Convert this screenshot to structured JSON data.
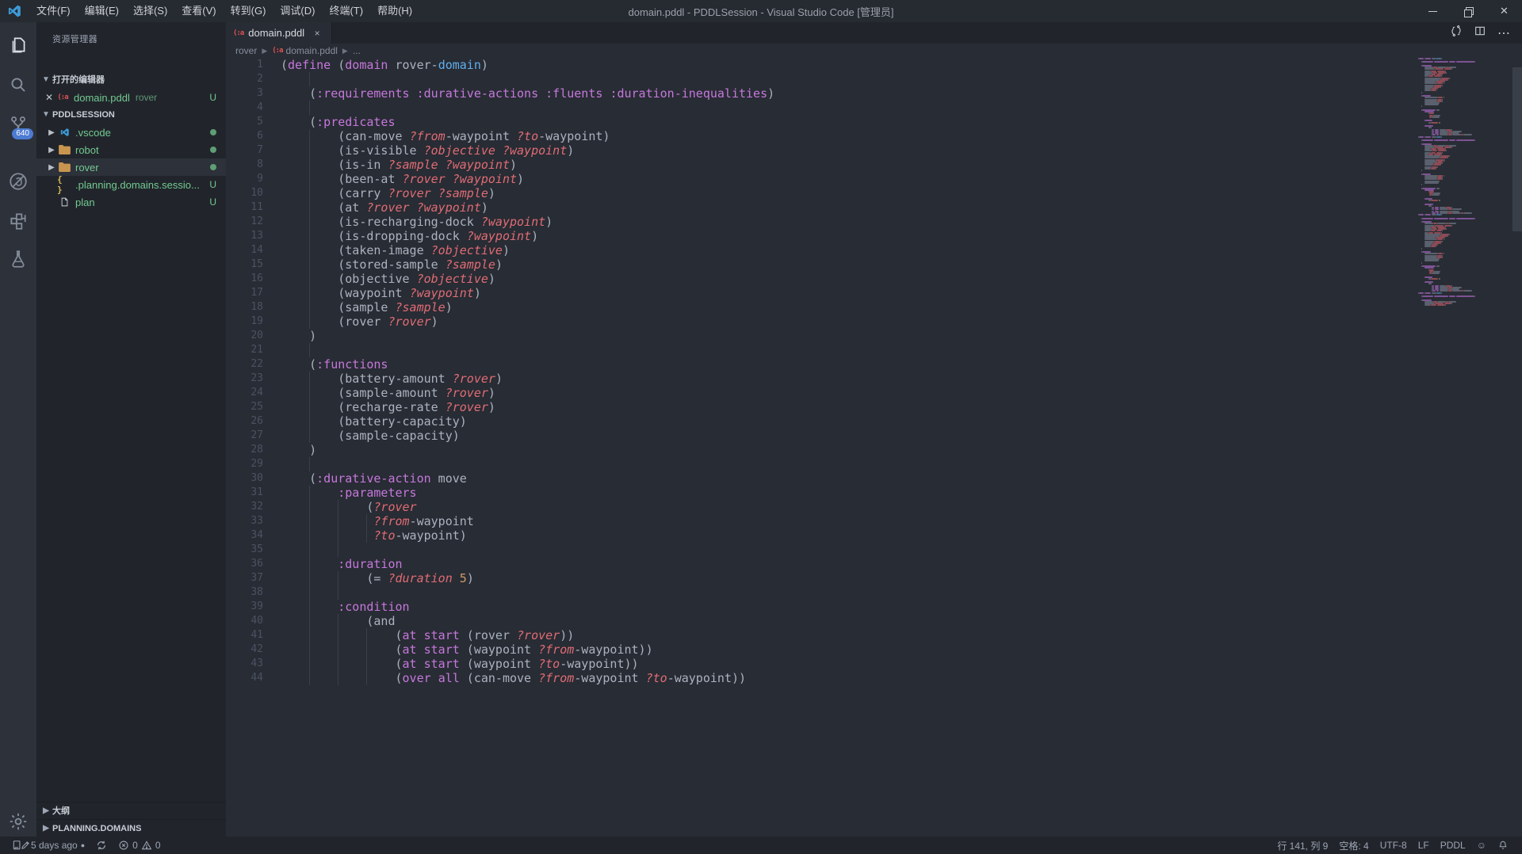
{
  "title_bar": {
    "menus": [
      {
        "label": "文件(F)"
      },
      {
        "label": "编辑(E)"
      },
      {
        "label": "选择(S)"
      },
      {
        "label": "查看(V)"
      },
      {
        "label": "转到(G)"
      },
      {
        "label": "调试(D)"
      },
      {
        "label": "终端(T)"
      },
      {
        "label": "帮助(H)"
      }
    ],
    "title": "domain.pddl - PDDLSession - Visual Studio Code [管理员]"
  },
  "activity_bar": {
    "items": [
      {
        "name": "explorer",
        "active": true
      },
      {
        "name": "search",
        "active": false
      },
      {
        "name": "source-control",
        "active": false,
        "badge": "640"
      },
      {
        "name": "debug-disabled",
        "active": false
      },
      {
        "name": "extensions",
        "active": false
      },
      {
        "name": "test-explorer",
        "active": false
      }
    ]
  },
  "sidebar": {
    "title": "资源管理器",
    "open_editors_label": "打开的编辑器",
    "open_editors": [
      {
        "name": "domain.pddl",
        "description": "rover",
        "badge": "U",
        "icon": "pddl"
      }
    ],
    "project_label": "PDDLSESSION",
    "tree": [
      {
        "name": ".vscode",
        "icon": "vscode",
        "chevron": true,
        "dot": true
      },
      {
        "name": "robot",
        "icon": "folder",
        "chevron": true,
        "dot": true
      },
      {
        "name": "rover",
        "icon": "folder",
        "chevron": true,
        "dot": true,
        "selected": true
      },
      {
        "name": ".planning.domains.sessio...",
        "icon": "json",
        "badge": "U"
      },
      {
        "name": "plan",
        "icon": "file",
        "badge": "U"
      }
    ],
    "outline_label": "大纲",
    "planning_domains_label": "PLANNING.DOMAINS"
  },
  "editor": {
    "tab": {
      "name": "domain.pddl",
      "icon_text": "(:a",
      "close": "×"
    },
    "breadcrumb": {
      "folder": "rover",
      "file": "domain.pddl",
      "tail": "...",
      "icon_text": "(:a"
    },
    "pddl_icon_color": "#e05252",
    "lines": [
      [
        1,
        [],
        [
          [
            "p",
            "("
          ],
          [
            "k",
            "define"
          ],
          [
            "p",
            " ("
          ],
          [
            "k",
            "domain"
          ],
          [
            "p",
            " rover-"
          ],
          [
            "b",
            "domain"
          ],
          [
            "p",
            ")"
          ]
        ]
      ],
      [
        2,
        [
          4
        ],
        []
      ],
      [
        3,
        [],
        [
          [
            "p",
            "    ("
          ],
          [
            "k",
            ":requirements"
          ],
          [
            "p",
            " "
          ],
          [
            "k",
            ":durative-actions"
          ],
          [
            "p",
            " "
          ],
          [
            "k",
            ":fluents"
          ],
          [
            "p",
            " "
          ],
          [
            "k",
            ":duration-inequalities"
          ],
          [
            "p",
            ")"
          ]
        ]
      ],
      [
        4,
        [
          4
        ],
        []
      ],
      [
        5,
        [],
        [
          [
            "p",
            "    ("
          ],
          [
            "k",
            ":predicates"
          ]
        ]
      ],
      [
        6,
        [
          4
        ],
        [
          [
            "p",
            "        (can-move "
          ],
          [
            "v",
            "?from"
          ],
          [
            "p",
            "-waypoint "
          ],
          [
            "v",
            "?to"
          ],
          [
            "p",
            "-waypoint)"
          ]
        ]
      ],
      [
        7,
        [
          4
        ],
        [
          [
            "p",
            "        (is-visible "
          ],
          [
            "v",
            "?objective"
          ],
          [
            "p",
            " "
          ],
          [
            "v",
            "?waypoint"
          ],
          [
            "p",
            ")"
          ]
        ]
      ],
      [
        8,
        [
          4
        ],
        [
          [
            "p",
            "        (is-in "
          ],
          [
            "v",
            "?sample"
          ],
          [
            "p",
            " "
          ],
          [
            "v",
            "?waypoint"
          ],
          [
            "p",
            ")"
          ]
        ]
      ],
      [
        9,
        [
          4
        ],
        [
          [
            "p",
            "        (been-at "
          ],
          [
            "v",
            "?rover"
          ],
          [
            "p",
            " "
          ],
          [
            "v",
            "?waypoint"
          ],
          [
            "p",
            ")"
          ]
        ]
      ],
      [
        10,
        [
          4
        ],
        [
          [
            "p",
            "        (carry "
          ],
          [
            "v",
            "?rover"
          ],
          [
            "p",
            " "
          ],
          [
            "v",
            "?sample"
          ],
          [
            "p",
            ")"
          ]
        ]
      ],
      [
        11,
        [
          4
        ],
        [
          [
            "p",
            "        (at "
          ],
          [
            "v",
            "?rover"
          ],
          [
            "p",
            " "
          ],
          [
            "v",
            "?waypoint"
          ],
          [
            "p",
            ")"
          ]
        ]
      ],
      [
        12,
        [
          4
        ],
        [
          [
            "p",
            "        (is-recharging-dock "
          ],
          [
            "v",
            "?waypoint"
          ],
          [
            "p",
            ")"
          ]
        ]
      ],
      [
        13,
        [
          4
        ],
        [
          [
            "p",
            "        (is-dropping-dock "
          ],
          [
            "v",
            "?waypoint"
          ],
          [
            "p",
            ")"
          ]
        ]
      ],
      [
        14,
        [
          4
        ],
        [
          [
            "p",
            "        (taken-image "
          ],
          [
            "v",
            "?objective"
          ],
          [
            "p",
            ")"
          ]
        ]
      ],
      [
        15,
        [
          4
        ],
        [
          [
            "p",
            "        (stored-sample "
          ],
          [
            "v",
            "?sample"
          ],
          [
            "p",
            ")"
          ]
        ]
      ],
      [
        16,
        [
          4
        ],
        [
          [
            "p",
            "        (objective "
          ],
          [
            "v",
            "?objective"
          ],
          [
            "p",
            ")"
          ]
        ]
      ],
      [
        17,
        [
          4
        ],
        [
          [
            "p",
            "        (waypoint "
          ],
          [
            "v",
            "?waypoint"
          ],
          [
            "p",
            ")"
          ]
        ]
      ],
      [
        18,
        [
          4
        ],
        [
          [
            "p",
            "        (sample "
          ],
          [
            "v",
            "?sample"
          ],
          [
            "p",
            ")"
          ]
        ]
      ],
      [
        19,
        [
          4
        ],
        [
          [
            "p",
            "        (rover "
          ],
          [
            "v",
            "?rover"
          ],
          [
            "p",
            ")"
          ]
        ]
      ],
      [
        20,
        [],
        [
          [
            "p",
            "    )"
          ]
        ]
      ],
      [
        21,
        [
          4
        ],
        []
      ],
      [
        22,
        [],
        [
          [
            "p",
            "    ("
          ],
          [
            "k",
            ":functions"
          ]
        ]
      ],
      [
        23,
        [
          4
        ],
        [
          [
            "p",
            "        (battery-amount "
          ],
          [
            "v",
            "?rover"
          ],
          [
            "p",
            ")"
          ]
        ]
      ],
      [
        24,
        [
          4
        ],
        [
          [
            "p",
            "        (sample-amount "
          ],
          [
            "v",
            "?rover"
          ],
          [
            "p",
            ")"
          ]
        ]
      ],
      [
        25,
        [
          4
        ],
        [
          [
            "p",
            "        (recharge-rate "
          ],
          [
            "v",
            "?rover"
          ],
          [
            "p",
            ")"
          ]
        ]
      ],
      [
        26,
        [
          4
        ],
        [
          [
            "p",
            "        (battery-capacity)"
          ]
        ]
      ],
      [
        27,
        [
          4
        ],
        [
          [
            "p",
            "        (sample-capacity)"
          ]
        ]
      ],
      [
        28,
        [],
        [
          [
            "p",
            "    )"
          ]
        ]
      ],
      [
        29,
        [
          4
        ],
        []
      ],
      [
        30,
        [],
        [
          [
            "p",
            "    ("
          ],
          [
            "k",
            ":durative-action"
          ],
          [
            "p",
            " move"
          ]
        ]
      ],
      [
        31,
        [
          4
        ],
        [
          [
            "p",
            "        "
          ],
          [
            "k",
            ":parameters"
          ]
        ]
      ],
      [
        32,
        [
          4,
          8
        ],
        [
          [
            "p",
            "            ("
          ],
          [
            "v",
            "?rover"
          ]
        ]
      ],
      [
        33,
        [
          4,
          8,
          12
        ],
        [
          [
            "p",
            "             "
          ],
          [
            "v",
            "?from"
          ],
          [
            "p",
            "-waypoint"
          ]
        ]
      ],
      [
        34,
        [
          4,
          8,
          12
        ],
        [
          [
            "p",
            "             "
          ],
          [
            "v",
            "?to"
          ],
          [
            "p",
            "-waypoint)"
          ]
        ]
      ],
      [
        35,
        [
          4,
          8
        ],
        []
      ],
      [
        36,
        [
          4
        ],
        [
          [
            "p",
            "        "
          ],
          [
            "k",
            ":duration"
          ]
        ]
      ],
      [
        37,
        [
          4,
          8
        ],
        [
          [
            "p",
            "            (= "
          ],
          [
            "v",
            "?duration"
          ],
          [
            "p",
            " "
          ],
          [
            "n",
            "5"
          ],
          [
            "p",
            ")"
          ]
        ]
      ],
      [
        38,
        [
          4,
          8
        ],
        []
      ],
      [
        39,
        [
          4
        ],
        [
          [
            "p",
            "        "
          ],
          [
            "k",
            ":condition"
          ]
        ]
      ],
      [
        40,
        [
          4,
          8
        ],
        [
          [
            "p",
            "            (and"
          ]
        ]
      ],
      [
        41,
        [
          4,
          8,
          12
        ],
        [
          [
            "p",
            "                ("
          ],
          [
            "k",
            "at"
          ],
          [
            "p",
            " "
          ],
          [
            "k",
            "start"
          ],
          [
            "p",
            " (rover "
          ],
          [
            "v",
            "?rover"
          ],
          [
            "p",
            "))"
          ]
        ]
      ],
      [
        42,
        [
          4,
          8,
          12
        ],
        [
          [
            "p",
            "                ("
          ],
          [
            "k",
            "at"
          ],
          [
            "p",
            " "
          ],
          [
            "k",
            "start"
          ],
          [
            "p",
            " (waypoint "
          ],
          [
            "v",
            "?from"
          ],
          [
            "p",
            "-waypoint))"
          ]
        ]
      ],
      [
        43,
        [
          4,
          8,
          12
        ],
        [
          [
            "p",
            "                ("
          ],
          [
            "k",
            "at"
          ],
          [
            "p",
            " "
          ],
          [
            "k",
            "start"
          ],
          [
            "p",
            " (waypoint "
          ],
          [
            "v",
            "?to"
          ],
          [
            "p",
            "-waypoint))"
          ]
        ]
      ],
      [
        44,
        [
          4,
          8,
          12
        ],
        [
          [
            "p",
            "                ("
          ],
          [
            "k",
            "over"
          ],
          [
            "p",
            " "
          ],
          [
            "k",
            "all"
          ],
          [
            "p",
            " (can-move "
          ],
          [
            "v",
            "?from"
          ],
          [
            "p",
            "-waypoint "
          ],
          [
            "v",
            "?to"
          ],
          [
            "p",
            "-waypoint))"
          ]
        ]
      ]
    ]
  },
  "status_bar": {
    "last_commit": "5 days ago",
    "commit_dot": "●",
    "errors": "0",
    "warnings": "0",
    "line_col": "行 141, 列 9",
    "indentation": "空格: 4",
    "encoding": "UTF-8",
    "eol": "LF",
    "language": "PDDL"
  },
  "colors": {
    "keyword": "#c678dd",
    "variable": "#e06c75",
    "blue": "#61afef",
    "number": "#d19a66",
    "plain": "#abb2bf",
    "untracked_green": "#73c991"
  }
}
